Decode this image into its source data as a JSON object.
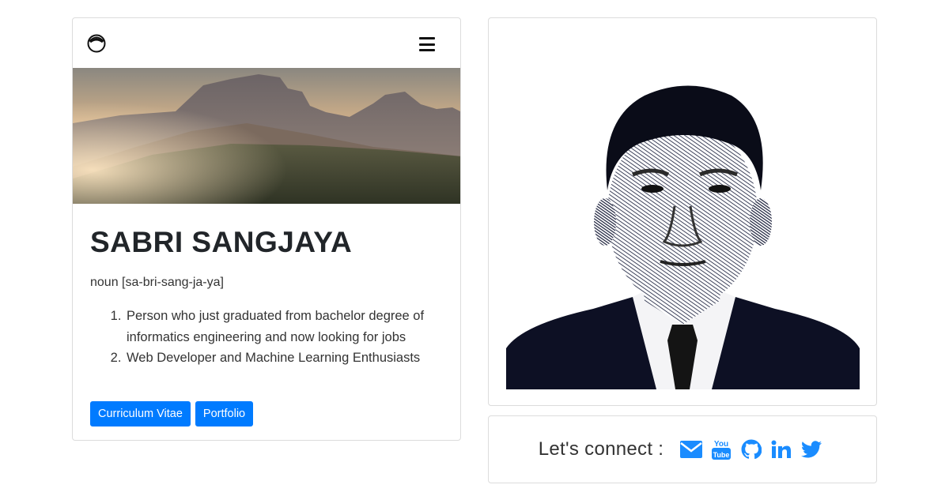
{
  "profile": {
    "name": "SABRI SANGJAYA",
    "pronunciation": "noun [sa-bri-sang-ja-ya]",
    "definitions": [
      "Person who just graduated from bachelor degree of informatics engineering and now looking for jobs",
      "Web Developer and Machine Learning Enthusiasts"
    ]
  },
  "buttons": {
    "cv_label": "Curriculum Vitae",
    "portfolio_label": "Portfolio"
  },
  "navbar": {
    "brand_icon": "brand-logo-icon",
    "menu_icon": "hamburger-menu-icon"
  },
  "connect": {
    "label": "Let's connect :",
    "icons": [
      "email-icon",
      "youtube-icon",
      "github-icon",
      "linkedin-icon",
      "twitter-icon"
    ],
    "youtube_text": [
      "You",
      "Tube"
    ]
  },
  "colors": {
    "accent": "#007bff",
    "social": "#1a8cff"
  }
}
